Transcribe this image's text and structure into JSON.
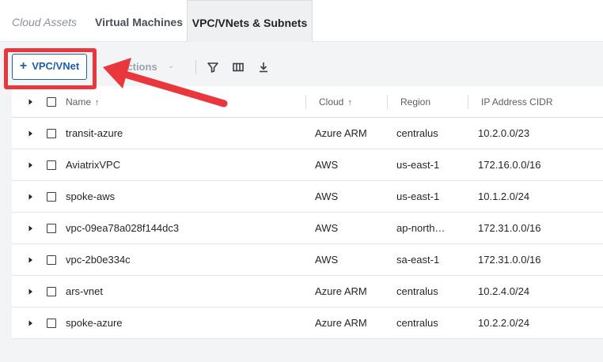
{
  "tabs": [
    {
      "label": "Cloud Assets"
    },
    {
      "label": "Virtual Machines"
    },
    {
      "label": "VPC/VNets & Subnets"
    }
  ],
  "toolbar": {
    "add_label": "VPC/VNet",
    "actions_label": "Actions"
  },
  "table": {
    "columns": [
      "Name",
      "Cloud",
      "Region",
      "IP Address CIDR"
    ],
    "rows": [
      {
        "name": "transit-azure",
        "cloud": "Azure ARM",
        "region": "centralus",
        "cidr": "10.2.0.0/23"
      },
      {
        "name": "AviatrixVPC",
        "cloud": "AWS",
        "region": "us-east-1",
        "cidr": "172.16.0.0/16"
      },
      {
        "name": "spoke-aws",
        "cloud": "AWS",
        "region": "us-east-1",
        "cidr": "10.1.2.0/24"
      },
      {
        "name": "vpc-09ea78a028f144dc3",
        "cloud": "AWS",
        "region": "ap-north…",
        "cidr": "172.31.0.0/16"
      },
      {
        "name": "vpc-2b0e334c",
        "cloud": "AWS",
        "region": "sa-east-1",
        "cidr": "172.31.0.0/16"
      },
      {
        "name": "ars-vnet",
        "cloud": "Azure ARM",
        "region": "centralus",
        "cidr": "10.2.4.0/24"
      },
      {
        "name": "spoke-azure",
        "cloud": "Azure ARM",
        "region": "centralus",
        "cidr": "10.2.2.0/24"
      }
    ]
  },
  "colors": {
    "accent": "#1f5fa8",
    "annotation": "#e8383d"
  },
  "icons": [
    "plus-icon",
    "chevron-down-icon",
    "filter-icon",
    "columns-icon",
    "download-icon",
    "expand-caret-icon",
    "sort-up-arrow-icon",
    "annotation-arrow"
  ]
}
